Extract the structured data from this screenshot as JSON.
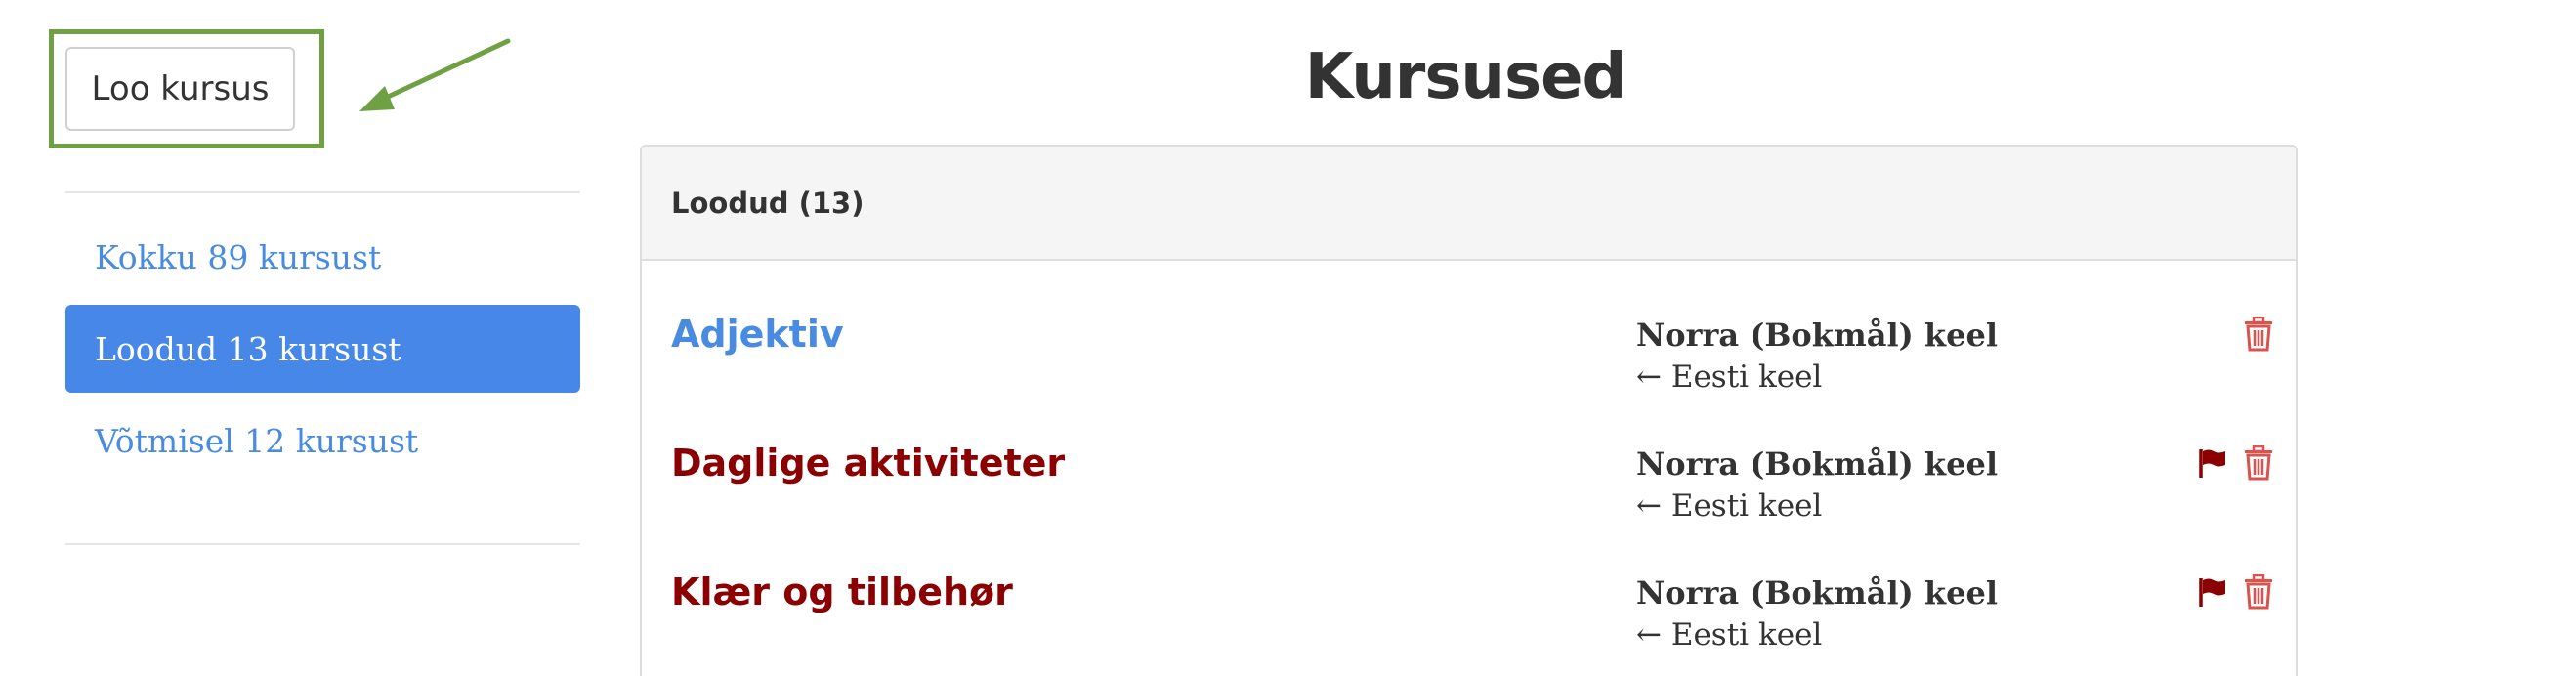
{
  "toolbar": {
    "create_label": "Loo kursus"
  },
  "sidebar": {
    "items": [
      {
        "label": "Kokku 89 kursust",
        "active": false
      },
      {
        "label": "Loodud 13 kursust",
        "active": true
      },
      {
        "label": "Võtmisel 12 kursust",
        "active": false
      }
    ]
  },
  "main": {
    "title": "Kursused",
    "panel_heading": "Loodud (13)",
    "courses": [
      {
        "title": "Adjektiv",
        "target_lang": "Norra (Bokmål) keel",
        "source_lang": "← Eesti keel",
        "flag": false
      },
      {
        "title": "Daglige aktiviteter",
        "target_lang": "Norra (Bokmål) keel",
        "source_lang": "← Eesti keel",
        "flag": true
      },
      {
        "title": "Klær og tilbehør",
        "target_lang": "Norra (Bokmål) keel",
        "source_lang": "← Eesti keel",
        "flag": true
      }
    ]
  },
  "colors": {
    "accent_blue": "#4687e8",
    "link_blue": "#4a8be2",
    "dark_red": "#8b0000",
    "trash_red": "#d9534f",
    "highlight_green": "#6fa043"
  },
  "icons": {
    "delete": "trash-icon",
    "flag": "flag-icon",
    "annotation": "arrow-icon"
  }
}
